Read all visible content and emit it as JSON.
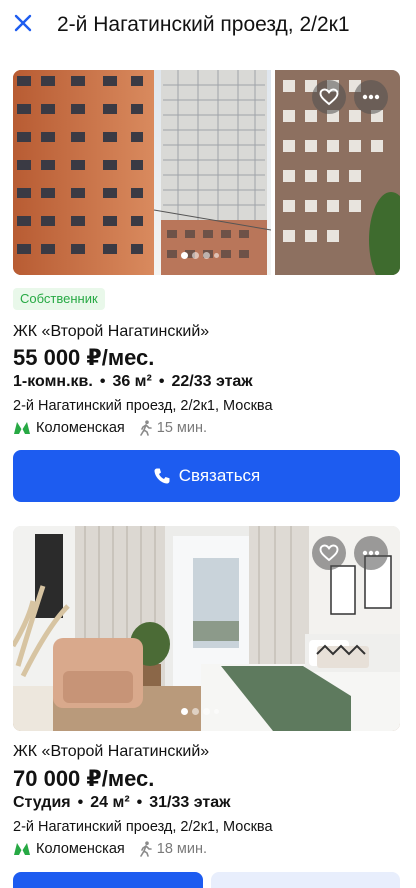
{
  "header": {
    "title": "2-й Нагатинский проезд, 2/2к1",
    "close_icon": "close-icon"
  },
  "listings": [
    {
      "badge": "Собственник",
      "complex": "ЖК «Второй Нагатинский»",
      "price": "55 000 ₽/мес.",
      "rooms": "1-комн.кв.",
      "area": "36 м²",
      "floor": "22/33 этаж",
      "address": "2-й Нагатинский проезд, 2/2к1, Москва",
      "metro": "Коломенская",
      "walk": "15 мин.",
      "photo_count_dots": 4,
      "active_dot": 0,
      "call_label": "Связаться"
    },
    {
      "complex": "ЖК «Второй Нагатинский»",
      "price": "70 000 ₽/мес.",
      "rooms": "Студия",
      "area": "24 м²",
      "floor": "31/33 этаж",
      "address": "2-й Нагатинский проезд, 2/2к1, Москва",
      "metro": "Коломенская",
      "walk": "18 мин.",
      "photo_count_dots": 4,
      "active_dot": 0
    }
  ],
  "colors": {
    "accent": "#1d5cf0",
    "metro": "#27a944",
    "badge_bg": "#e9f8ea",
    "badge_text": "#27a944"
  },
  "separator": "•"
}
